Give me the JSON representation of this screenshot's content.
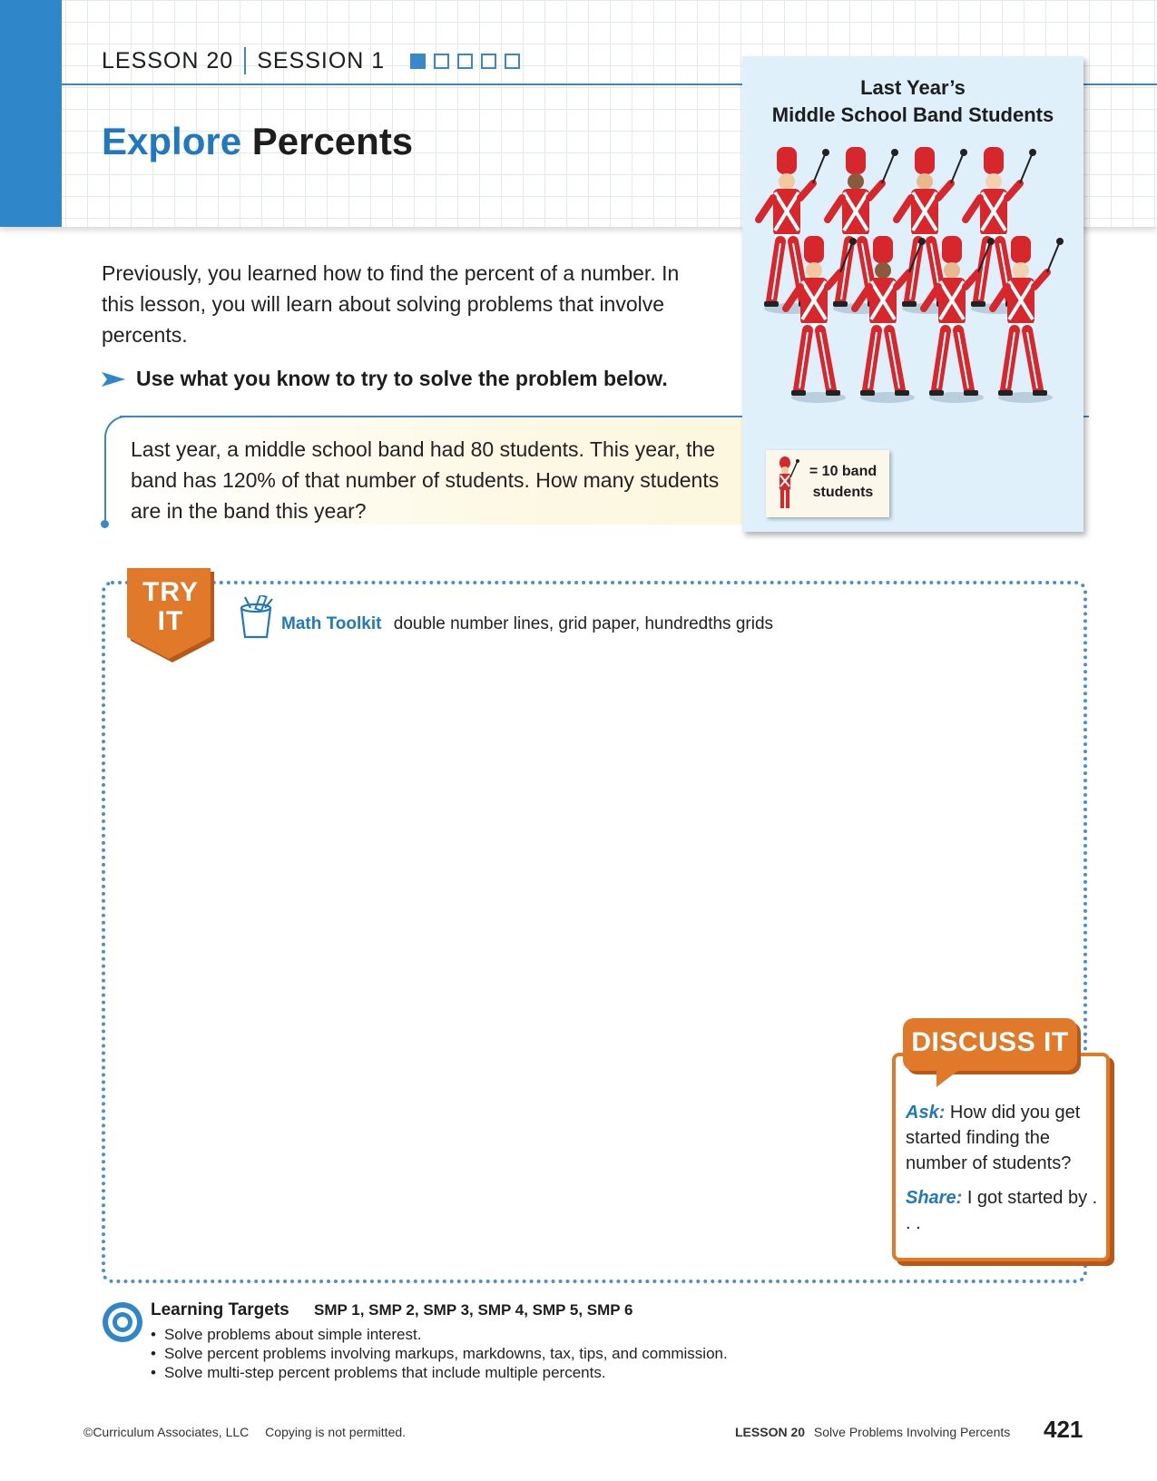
{
  "header": {
    "lesson": "LESSON 20",
    "session": "SESSION 1",
    "session_progress": {
      "current": 1,
      "total": 5
    },
    "title_strong": "Explore",
    "title_rest": "Percents",
    "accent_color": "#2f86c8"
  },
  "intro": {
    "text": "Previously, you learned how to find the percent of a number. In this lesson, you will learn about solving problems that involve percents.",
    "directive": "Use what you know to try to solve the problem below."
  },
  "problem": {
    "text": "Last year, a middle school band had 80 students. This year, the band has 120% of that number of students. How many students are in the band this year?"
  },
  "figure": {
    "title_line1": "Last Year’s",
    "title_line2": "Middle School Band Students",
    "key_line1": "= 10 band",
    "key_line2": "students",
    "figure_count": 8,
    "uniform_color": "#d8262d"
  },
  "try_it": {
    "badge_line1": "TRY",
    "badge_line2": "IT",
    "toolkit_label": "Math Toolkit",
    "toolkit_items": "double number lines, grid paper, hundredths grids",
    "badge_color": "#e0792a"
  },
  "discuss": {
    "title": "DISCUSS IT",
    "ask_label": "Ask:",
    "ask_text": "How did you get started finding the number of students?",
    "share_label": "Share:",
    "share_text": "I got started by . . ."
  },
  "learning_targets": {
    "title": "Learning Targets",
    "smp": "SMP 1, SMP 2, SMP 3, SMP 4, SMP 5, SMP 6",
    "items": [
      "Solve problems about simple interest.",
      "Solve percent problems involving markups, markdowns, tax, tips, and commission.",
      "Solve multi-step percent problems that include multiple percents."
    ]
  },
  "footer": {
    "copyright": "©Curriculum Associates, LLC",
    "notice": "Copying is not permitted.",
    "lesson_label": "LESSON 20",
    "lesson_title": "Solve Problems Involving Percents",
    "page_number": "421"
  }
}
